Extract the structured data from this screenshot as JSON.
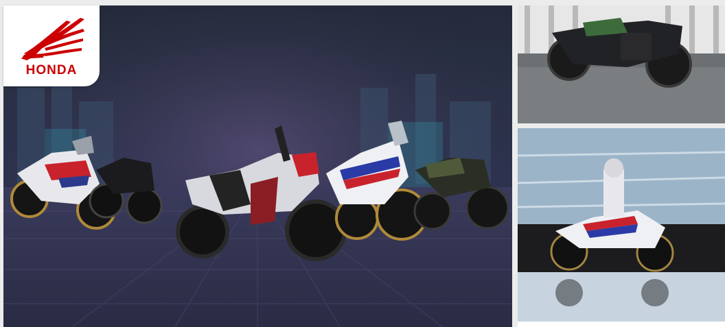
{
  "brand": {
    "name": "HONDA",
    "color": "#cc0000"
  },
  "hero": {
    "label": "hero-motorcycle-lineup"
  },
  "side_top": {
    "label": "scrambler-motorcycle-photo"
  },
  "side_bottom": {
    "label": "adventure-rider-beach-photo"
  },
  "colors": {
    "accent": "#cc0000",
    "background": "#2b3147"
  }
}
